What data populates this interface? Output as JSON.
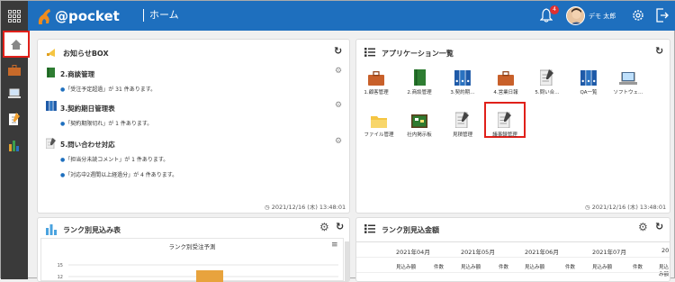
{
  "header": {
    "app_name": "@pocket",
    "page_title": "ホーム",
    "notification_count": "4",
    "user_name": "デモ 太郎"
  },
  "notice_box": {
    "title": "お知らせBOX",
    "sections": [
      {
        "title": "2.商談管理",
        "lines": [
          "「受注予定超過」が 31 件あります。"
        ]
      },
      {
        "title": "3.契約期日管理表",
        "lines": [
          "「契約期限切れ」が 1 件あります。"
        ]
      },
      {
        "title": "5.問い合わせ対応",
        "lines": [
          "「担当分未読コメント」が 1 件あります。",
          "「対応中2週間以上経過分」が 4 件あります。"
        ]
      }
    ],
    "timestamp": "2021/12/16 (木) 13:48:01"
  },
  "apps_panel": {
    "title": "アプリケーション一覧",
    "apps": [
      {
        "label": "1.顧客管理",
        "icon": "briefcase-icon"
      },
      {
        "label": "2.商談管理",
        "icon": "book-icon"
      },
      {
        "label": "3.契約期…",
        "icon": "binders-icon"
      },
      {
        "label": "4.営業日報",
        "icon": "briefcase-icon"
      },
      {
        "label": "5.問い合…",
        "icon": "notepad-icon"
      },
      {
        "label": "QA一覧",
        "icon": "binders-icon"
      },
      {
        "label": "ソフトウェ…",
        "icon": "laptop-icon"
      },
      {
        "label": "ファイル管理",
        "icon": "folder-icon"
      },
      {
        "label": "社内掲示板",
        "icon": "board-icon"
      },
      {
        "label": "見積管理",
        "icon": "notepad-icon"
      },
      {
        "label": "議事録管理",
        "icon": "notepad-icon"
      }
    ],
    "timestamp": "2021/12/16 (木) 13:48:01"
  },
  "rank_panel": {
    "title": "ランク別見込み表",
    "chart_title": "ランク別受注予測"
  },
  "chart_data": {
    "type": "bar",
    "title": "ランク別受注予測",
    "ytick_labels": [
      "15",
      "12"
    ],
    "ylim": [
      0,
      15
    ],
    "values": [
      12
    ]
  },
  "amount_panel": {
    "title": "ランク別見込金額",
    "months": [
      "2021年04月",
      "2021年05月",
      "2021年06月",
      "2021年07月",
      "20"
    ],
    "sub_headers": [
      "見込み額",
      "件数"
    ]
  }
}
